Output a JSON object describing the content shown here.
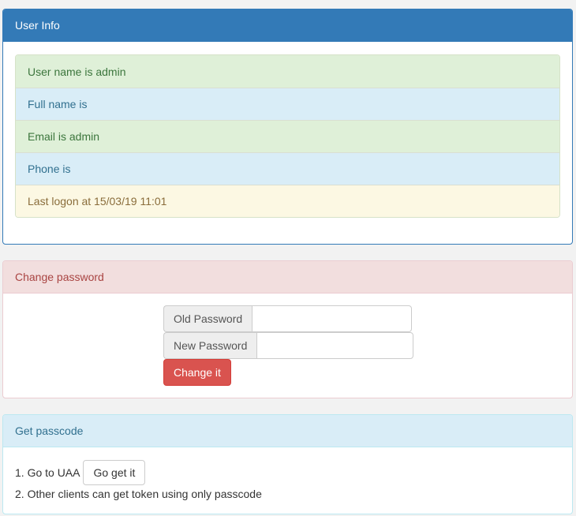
{
  "user_info": {
    "title": "User Info",
    "items": [
      {
        "text": "User name is admin"
      },
      {
        "text": "Full name is"
      },
      {
        "text": "Email is admin"
      },
      {
        "text": "Phone is"
      },
      {
        "text": "Last logon at 15/03/19 11:01"
      }
    ]
  },
  "change_password": {
    "title": "Change password",
    "old_label": "Old Password",
    "old_value": "",
    "new_label": "New Password",
    "new_value": "",
    "submit_label": "Change it"
  },
  "passcode": {
    "title": "Get passcode",
    "step1_text": "1. Go to UAA",
    "step1_button": "Go get it",
    "step2_text": "2. Other clients can get token using only passcode"
  },
  "colors": {
    "primary": "#337ab7",
    "danger": "#d9534f",
    "success_bg": "#dff0d8",
    "info_bg": "#d9edf7",
    "warning_bg": "#fcf8e3"
  }
}
